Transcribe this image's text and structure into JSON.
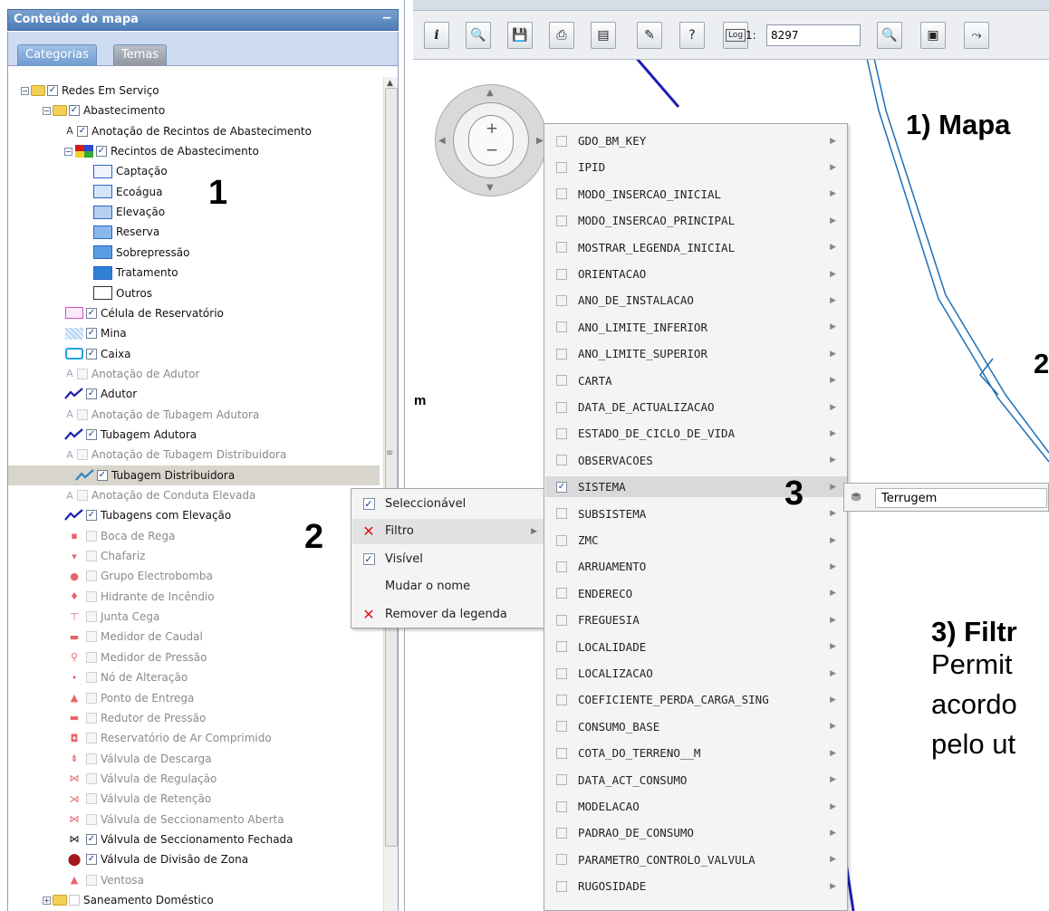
{
  "panel": {
    "title": "Conteúdo do mapa",
    "minimize": "−",
    "tabs": [
      "Categorias",
      "Temas"
    ]
  },
  "tree": [
    {
      "label": "Redes Em Serviço",
      "indent": 0,
      "kind": "folder",
      "checked": true,
      "expander": "−"
    },
    {
      "label": "Abastecimento",
      "indent": 1,
      "kind": "folder",
      "checked": true,
      "expander": "−"
    },
    {
      "label": "Anotação de Recintos de Abastecimento",
      "indent": 2,
      "kind": "annot",
      "checked": true
    },
    {
      "label": "Recintos de Abastecimento",
      "indent": 2,
      "kind": "multicolor",
      "checked": true,
      "expander": "−"
    },
    {
      "label": "Captação",
      "indent": 3,
      "kind": "legend",
      "fill": "#eef4fd"
    },
    {
      "label": "Ecoágua",
      "indent": 3,
      "kind": "legend",
      "fill": "#d3e3f8"
    },
    {
      "label": "Elevação",
      "indent": 3,
      "kind": "legend",
      "fill": "#b3cff2"
    },
    {
      "label": "Reserva",
      "indent": 3,
      "kind": "legend",
      "fill": "#8ab8ec"
    },
    {
      "label": "Sobrepressão",
      "indent": 3,
      "kind": "legend",
      "fill": "#5a9ce3"
    },
    {
      "label": "Tratamento",
      "indent": 3,
      "kind": "legend",
      "fill": "#2f7fd6"
    },
    {
      "label": "Outros",
      "indent": 3,
      "kind": "legend-outros",
      "fill": "#ffffff"
    },
    {
      "label": "Célula de Reservatório",
      "indent": 2,
      "kind": "pink-box",
      "checked": true
    },
    {
      "label": "Mina",
      "indent": 2,
      "kind": "mina",
      "checked": true
    },
    {
      "label": "Caixa",
      "indent": 2,
      "kind": "caixa",
      "checked": true
    },
    {
      "label": "Anotação de Adutor",
      "indent": 2,
      "kind": "annot",
      "checked": false,
      "disabled": true
    },
    {
      "label": "Adutor",
      "indent": 2,
      "kind": "line",
      "checked": true
    },
    {
      "label": "Anotação de Tubagem Adutora",
      "indent": 2,
      "kind": "annot",
      "checked": false,
      "disabled": true
    },
    {
      "label": "Tubagem Adutora",
      "indent": 2,
      "kind": "line",
      "checked": true
    },
    {
      "label": "Anotação de Tubagem Distribuidora",
      "indent": 2,
      "kind": "annot",
      "checked": false,
      "disabled": true
    },
    {
      "label": "Tubagem Distribuidora",
      "indent": 2,
      "kind": "line-light",
      "checked": true,
      "selected": true
    },
    {
      "label": "Anotação de Conduta Elevada",
      "indent": 2,
      "kind": "annot",
      "checked": false,
      "disabled": true
    },
    {
      "label": "Tubagens com Elevação",
      "indent": 2,
      "kind": "line",
      "checked": true
    },
    {
      "label": "Boca de Rega",
      "indent": 2,
      "kind": "red-sym",
      "sym": "▪",
      "disabled": true
    },
    {
      "label": "Chafariz",
      "indent": 2,
      "kind": "red-sym",
      "sym": "▾",
      "disabled": true
    },
    {
      "label": "Grupo Electrobomba",
      "indent": 2,
      "kind": "red-sym",
      "sym": "●",
      "disabled": true
    },
    {
      "label": "Hidrante de Incêndio",
      "indent": 2,
      "kind": "red-sym",
      "sym": "♦",
      "disabled": true
    },
    {
      "label": "Junta Cega",
      "indent": 2,
      "kind": "red-sym",
      "sym": "⊤",
      "disabled": true
    },
    {
      "label": "Medidor de Caudal",
      "indent": 2,
      "kind": "red-sym",
      "sym": "▬",
      "disabled": true
    },
    {
      "label": "Medidor de Pressão",
      "indent": 2,
      "kind": "red-sym",
      "sym": "⚲",
      "disabled": true
    },
    {
      "label": "Nó de Alteração",
      "indent": 2,
      "kind": "red-sym",
      "sym": "•",
      "disabled": true
    },
    {
      "label": "Ponto de Entrega",
      "indent": 2,
      "kind": "red-sym",
      "sym": "▲",
      "disabled": true
    },
    {
      "label": "Redutor de Pressão",
      "indent": 2,
      "kind": "red-sym",
      "sym": "▬",
      "disabled": true
    },
    {
      "label": "Reservatório de Ar Comprimido",
      "indent": 2,
      "kind": "red-sym",
      "sym": "◘",
      "disabled": true
    },
    {
      "label": "Válvula de Descarga",
      "indent": 2,
      "kind": "red-sym",
      "sym": "⇟",
      "disabled": true
    },
    {
      "label": "Válvula de Regulação",
      "indent": 2,
      "kind": "red-sym",
      "sym": "⋈",
      "disabled": true
    },
    {
      "label": "Válvula de Retenção",
      "indent": 2,
      "kind": "red-sym",
      "sym": "⋊",
      "disabled": true
    },
    {
      "label": "Válvula de Seccionamento Aberta",
      "indent": 2,
      "kind": "red-sym",
      "sym": "⋈",
      "disabled": true
    },
    {
      "label": "Válvula de Seccionamento Fechada",
      "indent": 2,
      "kind": "black-sym",
      "sym": "⋈",
      "checked": true
    },
    {
      "label": "Válvula de Divisão de Zona",
      "indent": 2,
      "kind": "dark-circle",
      "sym": "⬤",
      "checked": true
    },
    {
      "label": "Ventosa",
      "indent": 2,
      "kind": "red-sym",
      "sym": "▲",
      "disabled": true
    },
    {
      "label": "Saneamento Doméstico",
      "indent": 1,
      "kind": "folder",
      "checked": false,
      "expander": "+"
    }
  ],
  "annotations": {
    "one": "1",
    "two": "2",
    "three": "3"
  },
  "toolbar": {
    "buttons": [
      {
        "name": "info-button",
        "glyph": "i"
      },
      {
        "name": "zoom-tool-button",
        "glyph": "🔍"
      },
      {
        "name": "save-button",
        "glyph": "💾"
      },
      {
        "name": "print-button",
        "glyph": "⎙"
      },
      {
        "name": "table-button",
        "glyph": "▤"
      },
      {
        "name": "attach-button",
        "glyph": "✎"
      },
      {
        "name": "help-button",
        "glyph": "?"
      },
      {
        "name": "log-button",
        "glyph": "Log"
      }
    ],
    "scale_prefix": "1:",
    "scale_value": "8297",
    "right_buttons": [
      {
        "name": "zoom-scale-button",
        "glyph": "🔍"
      },
      {
        "name": "layers-button",
        "glyph": "▣"
      },
      {
        "name": "route-button",
        "glyph": "⤳"
      }
    ]
  },
  "map": {
    "heading1": "1) Mapa",
    "heading2": "2",
    "heading3": "3) Filtr",
    "body_lines": [
      "Permit",
      "acordo",
      "pelo ut"
    ],
    "stray_letter": "m",
    "nav": {
      "plus": "+",
      "minus": "−"
    }
  },
  "context_menu": [
    {
      "label": "Seleccionável",
      "icon": "checkbox",
      "checked": true
    },
    {
      "label": "Filtro",
      "icon": "red-x",
      "submenu": true,
      "hover": true
    },
    {
      "label": "Visível",
      "icon": "checkbox",
      "checked": true
    },
    {
      "label": "Mudar o nome",
      "icon": "none"
    },
    {
      "label": "Remover da legenda",
      "icon": "red-x"
    }
  ],
  "attributes": [
    {
      "label": "GDO_BM_KEY",
      "checked": false
    },
    {
      "label": "IPID",
      "checked": false
    },
    {
      "label": "MODO_INSERCAO_INICIAL",
      "checked": false
    },
    {
      "label": "MODO_INSERCAO_PRINCIPAL",
      "checked": false
    },
    {
      "label": "MOSTRAR_LEGENDA_INICIAL",
      "checked": false
    },
    {
      "label": "ORIENTACAO",
      "checked": false
    },
    {
      "label": "ANO_DE_INSTALACAO",
      "checked": false
    },
    {
      "label": "ANO_LIMITE_INFERIOR",
      "checked": false
    },
    {
      "label": "ANO_LIMITE_SUPERIOR",
      "checked": false
    },
    {
      "label": "CARTA",
      "checked": false
    },
    {
      "label": "DATA_DE_ACTUALIZACAO",
      "checked": false
    },
    {
      "label": "ESTADO_DE_CICLO_DE_VIDA",
      "checked": false
    },
    {
      "label": "OBSERVACOES",
      "checked": false
    },
    {
      "label": "SISTEMA",
      "checked": true,
      "hover": true
    },
    {
      "label": "SUBSISTEMA",
      "checked": false
    },
    {
      "label": "ZMC",
      "checked": false
    },
    {
      "label": "ARRUAMENTO",
      "checked": false
    },
    {
      "label": "ENDERECO",
      "checked": false
    },
    {
      "label": "FREGUESIA",
      "checked": false
    },
    {
      "label": "LOCALIDADE",
      "checked": false
    },
    {
      "label": "LOCALIZACAO",
      "checked": false
    },
    {
      "label": "COEFICIENTE_PERDA_CARGA_SING",
      "checked": false
    },
    {
      "label": "CONSUMO_BASE",
      "checked": false
    },
    {
      "label": "COTA_DO_TERRENO__M",
      "checked": false
    },
    {
      "label": "DATA_ACT_CONSUMO",
      "checked": false
    },
    {
      "label": "MODELACAO",
      "checked": false
    },
    {
      "label": "PADRAO_DE_CONSUMO",
      "checked": false
    },
    {
      "label": "PARAMETRO_CONTROLO_VALVULA",
      "checked": false
    },
    {
      "label": "RUGOSIDADE",
      "checked": false
    }
  ],
  "filter_value": {
    "icon": "binoculars-icon",
    "value": "Terrugem"
  },
  "colors": {
    "pipe_dark": "#1d1fb5",
    "pipe_light": "#1f6fb5",
    "panel_header": "#5a86bf",
    "red_x": "#e0141b"
  }
}
